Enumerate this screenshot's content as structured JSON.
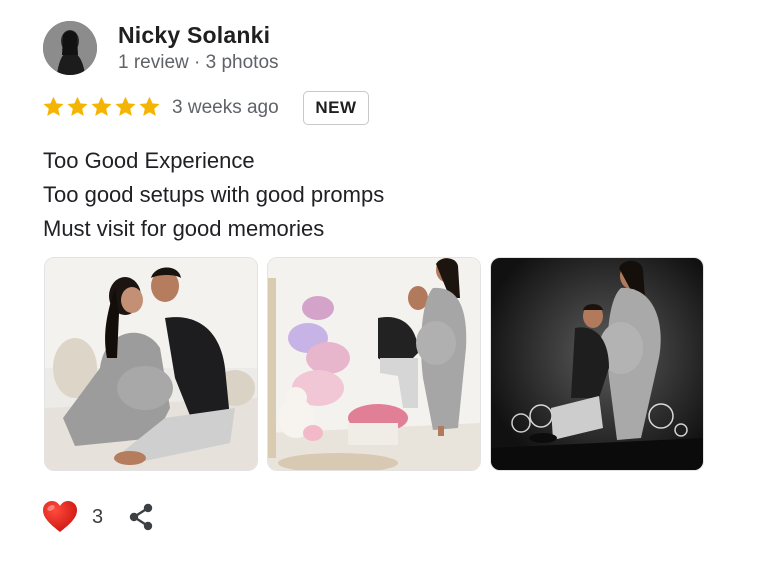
{
  "reviewer": {
    "name": "Nicky Solanki",
    "meta": "1 review · 3 photos"
  },
  "rating": {
    "stars": 5,
    "max": 5,
    "time": "3 weeks ago",
    "badge": "NEW"
  },
  "review_lines": [
    "Too Good Experience",
    "Too good setups with good promps",
    "Must visit for good memories"
  ],
  "photos": [
    {
      "description_icon": "photo-couple-on-bed"
    },
    {
      "description_icon": "photo-couple-with-flowers"
    },
    {
      "description_icon": "photo-couple-dark-studio"
    }
  ],
  "actions": {
    "like_count": "3",
    "like_icon": "heart-icon",
    "share_icon": "share-icon"
  },
  "colors": {
    "star": "#F4B400",
    "heart": "#E0201B",
    "secondary_text": "#5F6368"
  }
}
